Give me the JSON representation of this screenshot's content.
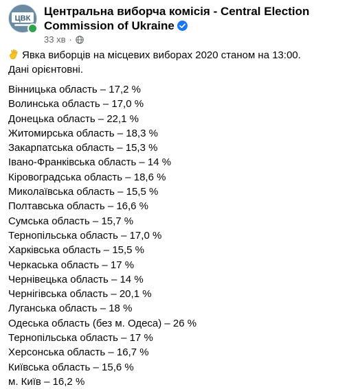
{
  "post": {
    "page_name": "Центральна виборча комісія - Central Election Commission of Ukraine",
    "avatar_text": "ЦВК",
    "time": "33 хв",
    "intro_line1": "Явка виборців на місцевих виборах 2020 станом на 13:00.",
    "intro_line2": "Дані орієнтовні.",
    "lines": [
      "Вінницька область – 17,2 %",
      "Волинська область – 17,0 %",
      "Донецька область – 22,1 %",
      "Житомирська область – 18,3 %",
      "Закарпатська область – 15,3 %",
      "Івано-Франківська область – 14 %",
      "Кіровоградська область – 18,6 %",
      "Миколаївська область – 15,5 %",
      "Полтавська область – 16,6 %",
      "Сумська область – 15,7 %",
      "Тернопільська область – 17,0 %",
      "Харківська область – 15,5 %",
      "Черкаська область – 17 %",
      "Чернівецька область – 14 %",
      "Чернігівська область – 20,1 %",
      "Луганська область – 18 %",
      "Одеська область (без м. Одеса) – 26 %",
      "Тернопільська область – 17 %",
      "Херсонська область – 16,7 %",
      "Київська область – 15,6 %",
      "м. Київ – 16,2 %"
    ]
  },
  "icons": {
    "verified": "verified-badge-icon",
    "globe": "globe-icon",
    "hand": "hand-emoji-icon"
  },
  "colors": {
    "text": "#050505",
    "secondary": "#65676b",
    "verified": "#1877f2",
    "online": "#31a24c",
    "hand": "#f7c325"
  }
}
